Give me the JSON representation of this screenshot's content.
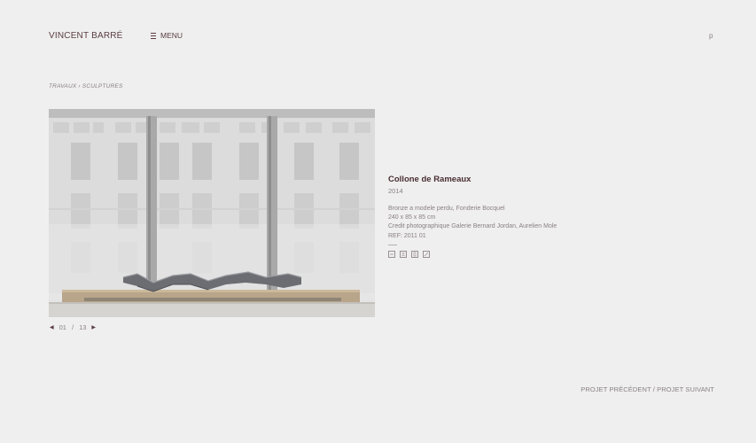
{
  "header": {
    "logo": "VINCENT BARRÉ",
    "menu_label": "MENU",
    "search_label": "p"
  },
  "breadcrumb": {
    "section": "TRAVAUX",
    "separator": " › ",
    "current": "SCULPTURES"
  },
  "artwork": {
    "title": "Collone de Rameaux",
    "year": "2014",
    "details": [
      "Bronze a modele perdu, Fonderie Bocquel",
      "240 x 85 x 85 cm",
      "Credit photographique Galerie Bernard Jordan, Aurelien Mole",
      "REF: 2011 01"
    ],
    "icons": [
      "minus-box-icon",
      "document-icon",
      "list-icon",
      "expand-icon"
    ]
  },
  "pager": {
    "current": "01",
    "separator": "/",
    "total": "13"
  },
  "project_nav": {
    "previous": "PROJET PRÉCÉDENT",
    "separator": " / ",
    "next": "PROJET SUIVANT"
  }
}
